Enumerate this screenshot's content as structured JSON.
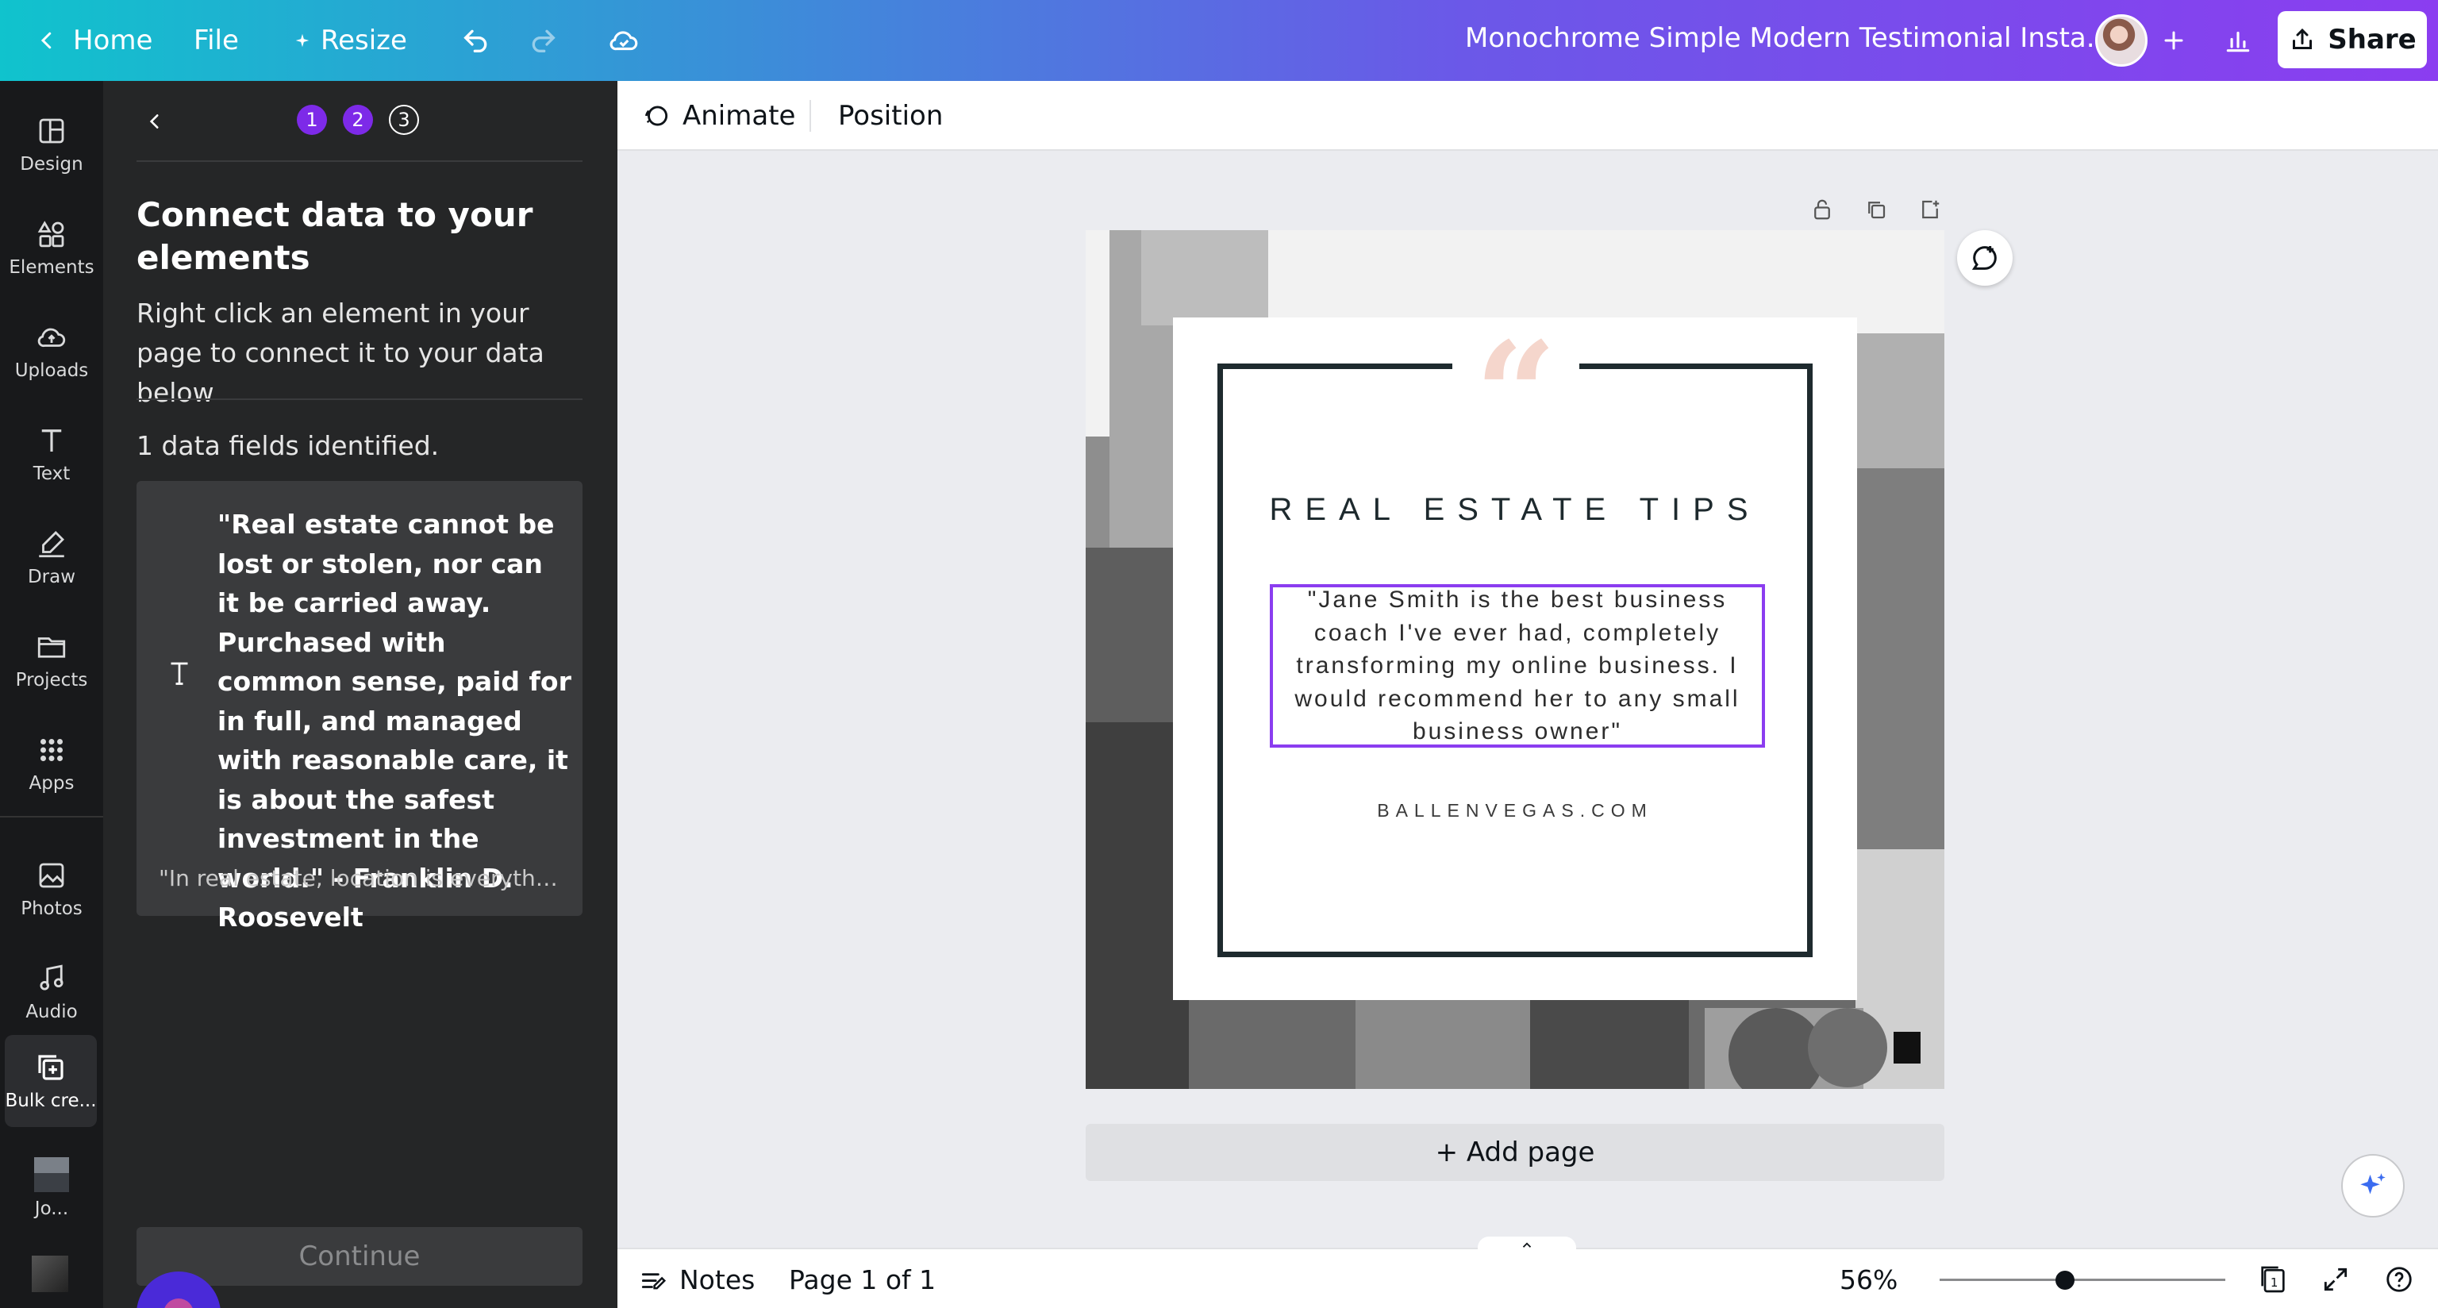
{
  "topbar": {
    "home_label": "Home",
    "file_label": "File",
    "resize_label": "Resize",
    "title": "Monochrome Simple Modern Testimonial Insta...",
    "share_label": "Share"
  },
  "sidebar": {
    "items": [
      {
        "label": "Design",
        "icon": "layout-icon"
      },
      {
        "label": "Elements",
        "icon": "shapes-icon"
      },
      {
        "label": "Uploads",
        "icon": "cloud-upload-icon"
      },
      {
        "label": "Text",
        "icon": "text-icon"
      },
      {
        "label": "Draw",
        "icon": "pen-icon"
      },
      {
        "label": "Projects",
        "icon": "folder-icon"
      },
      {
        "label": "Apps",
        "icon": "grid-icon"
      },
      {
        "label": "Photos",
        "icon": "image-icon"
      },
      {
        "label": "Audio",
        "icon": "music-icon"
      },
      {
        "label": "Bulk cre...",
        "icon": "bulk-create-icon"
      },
      {
        "label": "Jo...",
        "icon": "user-thumbnail"
      }
    ]
  },
  "panel": {
    "steps": [
      "1",
      "2",
      "3"
    ],
    "heading": "Connect data to your elements",
    "subtext": "Right click an element in your page to connect it to your data below",
    "count_text": "1 data fields identified.",
    "field_value": "\"Real estate cannot be lost or stolen, nor can it be carried away. Purchased with common sense, paid for in full, and managed with reasonable care, it is about the safest investment in the world.\" - Franklin D. Roosevelt",
    "field_next": "\"In real estate, location is everything...",
    "continue_label": "Continue"
  },
  "toolbar": {
    "animate_label": "Animate",
    "position_label": "Position"
  },
  "design": {
    "heading": "REAL ESTATE TIPS",
    "quote": "\"Jane Smith is the best business coach I've ever had, completely transforming my online business. I would recommend her to any small business owner\"",
    "website": "BALLENVEGAS.COM",
    "quote_color": "#f5d6cc",
    "frame_color": "#1e2a2e",
    "selection_color": "#8b3df0"
  },
  "canvas": {
    "add_page_label": "+ Add page"
  },
  "footer": {
    "notes_label": "Notes",
    "page_label": "Page 1 of 1",
    "zoom": "56%",
    "page_count": "1"
  },
  "colors": {
    "accent": "#7d2ae8",
    "gradient_start": "#10c3cd",
    "gradient_end": "#8b3df0"
  }
}
